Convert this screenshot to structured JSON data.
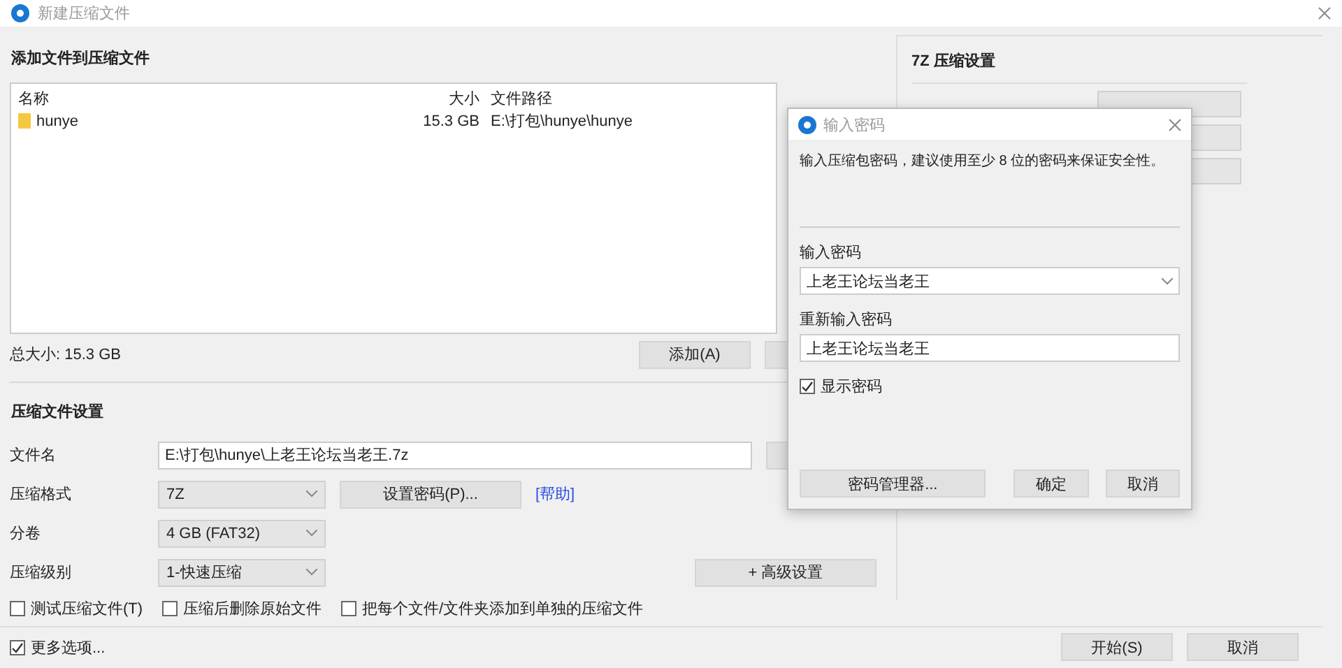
{
  "window": {
    "title": "新建压缩文件"
  },
  "files": {
    "heading": "添加文件到压缩文件",
    "columns": [
      "名称",
      "大小",
      "文件路径"
    ],
    "rows": [
      {
        "name": "hunye",
        "size": "15.3 GB",
        "path": "E:\\打包\\hunye\\hunye"
      }
    ],
    "total": "总大小: 15.3 GB",
    "add_button": "添加(A)"
  },
  "settings": {
    "heading": "压缩文件设置",
    "filename": {
      "label": "文件名",
      "value": "E:\\打包\\hunye\\上老王论坛当老王.7z"
    },
    "format": {
      "label": "压缩格式",
      "value": "7Z"
    },
    "password_button": "设置密码(P)...",
    "help_link": "[帮助]",
    "split": {
      "label": "分卷",
      "value": "4 GB (FAT32)"
    },
    "level": {
      "label": "压缩级别",
      "value": "1-快速压缩"
    },
    "advanced_button": "+ 高级设置",
    "options": [
      {
        "label": "测试压缩文件(T)",
        "checked": false
      },
      {
        "label": "压缩后删除原始文件",
        "checked": false
      },
      {
        "label": "把每个文件/文件夹添加到单独的压缩文件",
        "checked": false
      }
    ]
  },
  "more_options": {
    "label": "更多选项...",
    "checked": true
  },
  "footer_buttons": [
    "开始(S)",
    "取消"
  ],
  "side_panel": {
    "title": "7Z 压缩设置"
  },
  "password_dialog": {
    "title": "输入密码",
    "message": "输入压缩包密码，建议使用至少 8 位的密码来保证安全性。",
    "password": {
      "label": "输入密码",
      "value": "上老王论坛当老王"
    },
    "confirm": {
      "label": "重新输入密码",
      "value": "上老王论坛当老王"
    },
    "show_password": {
      "label": "显示密码",
      "checked": true
    },
    "buttons": [
      "密码管理器...",
      "确定",
      "取消"
    ]
  }
}
